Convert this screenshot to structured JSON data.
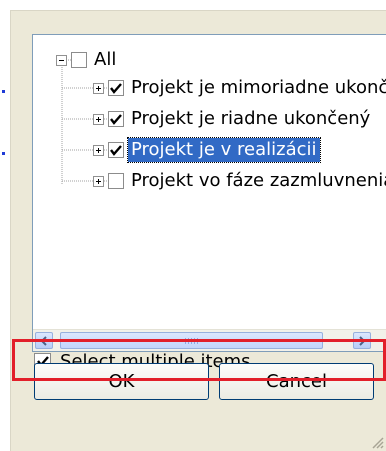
{
  "tree": {
    "root": {
      "label": "All",
      "checked": false,
      "expanded": true
    },
    "items": [
      {
        "label": "Projekt je mimoriadne ukončený",
        "checked": true,
        "selected": false
      },
      {
        "label": "Projekt je riadne ukončený",
        "checked": true,
        "selected": false
      },
      {
        "label": "Projekt je v realizácii",
        "checked": true,
        "selected": true
      },
      {
        "label": "Projekt vo fáze zazmluvnenia",
        "checked": false,
        "selected": false
      }
    ]
  },
  "multi_select": {
    "label": "Select multiple items",
    "mnemonic": "S",
    "rest": "elect multiple items",
    "checked": true
  },
  "buttons": {
    "ok_label": "OK",
    "cancel_label": "Cancel"
  },
  "colors": {
    "selection": "#316ac5",
    "highlight_box": "#e21f2a",
    "dialog_bg": "#ece9d8"
  },
  "icons": [
    "tree-expander-minus-icon",
    "tree-expander-plus-icon",
    "checkmark-icon",
    "scroll-left-arrow-icon",
    "scroll-right-arrow-icon",
    "resize-grip-icon"
  ]
}
